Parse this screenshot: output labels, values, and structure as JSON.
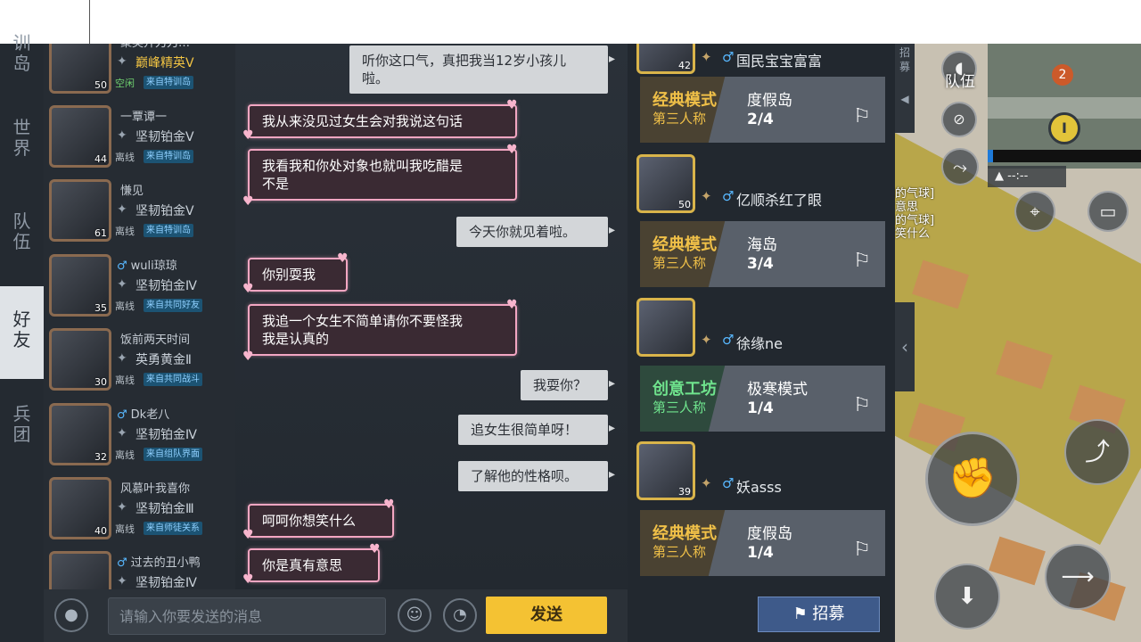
{
  "left_nav": {
    "items": [
      {
        "label": "训\n岛",
        "active": false
      },
      {
        "label": "世\n界",
        "active": false
      },
      {
        "label": "队\n伍",
        "active": false
      },
      {
        "label": "好\n友",
        "active": true
      },
      {
        "label": "兵\n团",
        "active": false
      }
    ]
  },
  "friends": [
    {
      "name": "聚英开刀刀…",
      "gender": "",
      "rank": "巅峰精英Ⅴ",
      "rank_gold": true,
      "status": "空闲",
      "online": true,
      "source": "来自特训岛",
      "level": "50"
    },
    {
      "name": "一覃谭一",
      "gender": "",
      "rank": "坚韧铂金Ⅴ",
      "rank_gold": false,
      "status": "离线",
      "online": false,
      "source": "来自特训岛",
      "level": "44"
    },
    {
      "name": "慊见",
      "gender": "",
      "rank": "坚韧铂金Ⅴ",
      "rank_gold": false,
      "status": "离线",
      "online": false,
      "source": "来自特训岛",
      "level": "61"
    },
    {
      "name": "wuli琼琼",
      "gender": "♂",
      "rank": "坚韧铂金Ⅳ",
      "rank_gold": false,
      "status": "离线",
      "online": false,
      "source": "来自共同好友",
      "level": "35"
    },
    {
      "name": "饭前两天时间",
      "gender": "",
      "rank": "英勇黄金Ⅱ",
      "rank_gold": false,
      "status": "离线",
      "online": false,
      "source": "来自共同战斗",
      "level": "30"
    },
    {
      "name": "Dk老八",
      "gender": "♂",
      "rank": "坚韧铂金Ⅳ",
      "rank_gold": false,
      "status": "离线",
      "online": false,
      "source": "来自组队界面",
      "level": "32"
    },
    {
      "name": "风慕叶我喜你",
      "gender": "",
      "rank": "坚韧铂金Ⅲ",
      "rank_gold": false,
      "status": "离线",
      "online": false,
      "source": "来自师徒关系",
      "level": "40"
    },
    {
      "name": "过去的丑小鸭",
      "gender": "♂",
      "rank": "坚韧铂金Ⅳ",
      "rank_gold": false,
      "status": "离线",
      "online": false,
      "source": "",
      "level": ""
    }
  ],
  "chat": {
    "messages": [
      {
        "side": "right",
        "text": "听你这口气，真把我当12岁小孩儿\n啦。"
      },
      {
        "side": "left",
        "text": "我从来没见过女生会对我说这句话"
      },
      {
        "side": "left",
        "text": "我看我和你处对象也就叫我吃醋是\n不是"
      },
      {
        "side": "right",
        "text": "今天你就见着啦。"
      },
      {
        "side": "left",
        "text": "你别耍我"
      },
      {
        "side": "left",
        "text": "我追一个女生不简单请你不要怪我\n我是认真的"
      },
      {
        "side": "right",
        "text": "我耍你？"
      },
      {
        "side": "right",
        "text": "追女生很简单呀！"
      },
      {
        "side": "right",
        "text": "了解他的性格呗。"
      },
      {
        "side": "left",
        "text": "呵呵你想笑什么"
      },
      {
        "side": "left",
        "text": "你是真有意思"
      }
    ]
  },
  "input_bar": {
    "placeholder": "请输入你要发送的消息",
    "send_label": "发送",
    "mic_icon": "mic-icon",
    "emoji_icon": "emoji-icon",
    "sticker_icon": "sticker-icon"
  },
  "recruit": {
    "entries": [
      {
        "player": "国民宝宝富富",
        "gender": "♂",
        "level": "42",
        "mode": "经典模式",
        "perspective": "第三人称",
        "map": "度假岛",
        "count": "2/4",
        "mode_color": "gold"
      },
      {
        "player": "亿顺杀红了眼",
        "gender": "♂",
        "level": "50",
        "mode": "经典模式",
        "perspective": "第三人称",
        "map": "海岛",
        "count": "3/4",
        "mode_color": "gold"
      },
      {
        "player": "徐缘ne",
        "gender": "♂",
        "level": "",
        "mode": "创意工坊",
        "perspective": "第三人称",
        "map": "极寒模式",
        "count": "1/4",
        "mode_color": "green"
      },
      {
        "player": "妖asss",
        "gender": "♂",
        "level": "39",
        "mode": "经典模式",
        "perspective": "第三人称",
        "map": "度假岛",
        "count": "1/4",
        "mode_color": "gold"
      }
    ],
    "recruit_button": "招募",
    "tab_label": "招\n募"
  },
  "hud": {
    "team_label": "队伍",
    "minimap_badge": "2",
    "compass_text": "I",
    "time_text": "--:--",
    "map_message": "的气球]\n意思\n的气球]\n笑什么"
  }
}
